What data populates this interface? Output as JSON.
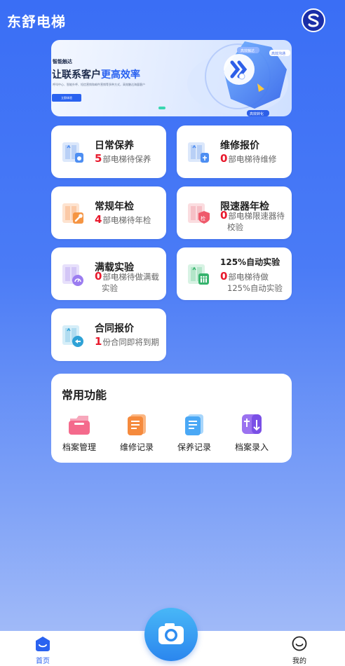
{
  "header": {
    "title": "东舒电梯",
    "logo_icon": "s-logo-icon"
  },
  "banner": {
    "small_text": "智能触达",
    "main_text_pre": "让联系客户",
    "main_text_highlight": "更高效率",
    "desc": "呼叫中心、智能外呼、短信营销和邮件营销等多种方式，高效触达海量客户",
    "button": "立即体验",
    "tag1": "高效触达",
    "tag2": "高效沟通",
    "tag3": "高效转化"
  },
  "cards": [
    {
      "title": "日常保养",
      "count": "5",
      "text": "部电梯待保养",
      "icon": "elevator-maintenance-icon"
    },
    {
      "title": "维修报价",
      "count": "0",
      "text": "部电梯待维修",
      "icon": "elevator-repair-icon"
    },
    {
      "title": "常规年检",
      "count": "4",
      "text": "部电梯待年检",
      "icon": "wrench-inspection-icon"
    },
    {
      "title": "限速器年检",
      "count": "0",
      "text": "部电梯限速器待",
      "text2": "校验",
      "icon": "speed-governor-icon",
      "badge": "检"
    },
    {
      "title": "满载实验",
      "count": "0",
      "text": "部电梯待做满载",
      "text2": "实验",
      "icon": "full-load-icon"
    },
    {
      "title": "125%自动实验",
      "count": "0",
      "text": "部电梯待做",
      "text2": "125%自动实验",
      "icon": "auto-test-icon"
    },
    {
      "title": "合同报价",
      "count": "1",
      "text": "份合同即将到期",
      "icon": "contract-icon"
    }
  ],
  "functions": {
    "title": "常用功能",
    "items": [
      {
        "label": "档案管理",
        "icon": "archive-manage-icon"
      },
      {
        "label": "维修记录",
        "icon": "repair-record-icon"
      },
      {
        "label": "保养记录",
        "icon": "maintenance-record-icon"
      },
      {
        "label": "档案录入",
        "icon": "archive-entry-icon"
      }
    ]
  },
  "tabbar": {
    "home": "首页",
    "mine": "我的",
    "camera_icon": "camera-icon"
  },
  "colors": {
    "accent": "#3a6ef5",
    "count_red": "#e8192c",
    "tab_active": "#2a62f0"
  }
}
